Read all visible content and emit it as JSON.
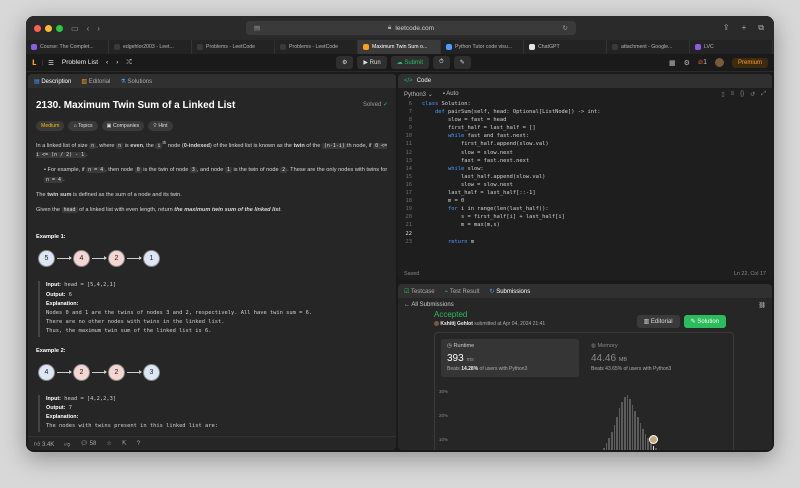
{
  "browser": {
    "url": "leetcode.com",
    "tabs": [
      {
        "label": "Course: The Complet...",
        "color": "#8c5ce6",
        "active": false
      },
      {
        "label": "edgehlor2003 - Leet...",
        "color": "#3a3a3a",
        "active": false
      },
      {
        "label": "Problems - LeetCode",
        "color": "#3a3a3a",
        "active": false
      },
      {
        "label": "Problems - LeetCode",
        "color": "#3a3a3a",
        "active": false
      },
      {
        "label": "Maximum Twin Sum o...",
        "color": "#ffa116",
        "active": true
      },
      {
        "label": "Python Tutor code visu...",
        "color": "#4a9eff",
        "active": false
      },
      {
        "label": "ChatGPT",
        "color": "#e6e6e6",
        "active": false
      },
      {
        "label": "attachment - Google...",
        "color": "#3a3a3a",
        "active": false
      },
      {
        "label": "LVC",
        "color": "#8c5ce6",
        "active": false
      }
    ]
  },
  "nav": {
    "problem_list": "Problem List",
    "run": "Run",
    "submit": "Submit",
    "streak": "1",
    "premium": "Premium"
  },
  "left": {
    "tabs": [
      "Description",
      "Editorial",
      "Solutions"
    ],
    "title": "2130. Maximum Twin Sum of a Linked List",
    "solved": "Solved",
    "pills": [
      "Medium",
      "Topics",
      "Companies",
      "Hint"
    ],
    "p1a": "In a linked list of size ",
    "p1_n": "n",
    "p1b": ", where ",
    "p1c": " is ",
    "p1_even": "even",
    "p1d": ", the ",
    "p1_ith": "i",
    "p1_th": "th",
    "p1e": " node (",
    "p1_zero": "0-indexed",
    "p1f": ") of the linked list is known as the ",
    "p1_twin": "twin",
    "p1g": " of the ",
    "p1_code": "(n-1-i)",
    "p1h": "th node, if ",
    "p1_range": "0 <= i <= (n / 2) - 1",
    "p1i": ".",
    "bullet_a": "For example, if ",
    "bullet_n4": "n = 4",
    "bullet_b": ", then node ",
    "bullet_0": "0",
    "bullet_c": " is the twin of node ",
    "bullet_3": "3",
    "bullet_d": ", and node ",
    "bullet_1": "1",
    "bullet_e": " is the twin of node ",
    "bullet_2": "2",
    "bullet_f": ". These are the only nodes with twins for ",
    "bullet_g": ".",
    "p2a": "The ",
    "p2_twin_sum": "twin sum",
    "p2b": " is defined as the sum of a node and its twin.",
    "p3a": "Given the ",
    "p3_head": "head",
    "p3b": " of a linked list with even length, return ",
    "p3_max": "the maximum twin sum of the linked list",
    "p3c": ".",
    "ex1_title": "Example 1:",
    "ex1_nodes": [
      "5",
      "4",
      "2",
      "1"
    ],
    "ex1_input_label": "Input:",
    "ex1_input": " head = [5,4,2,1]",
    "ex1_output_label": "Output:",
    "ex1_output": " 6",
    "ex1_expl_label": "Explanation:",
    "ex1_l1": "Nodes 0 and 1 are the twins of nodes 3 and 2, respectively. All have twin sum = 6.",
    "ex1_l2": "There are no other nodes with twins in the linked list.",
    "ex1_l3": "Thus, the maximum twin sum of the linked list is 6.",
    "ex2_title": "Example 2:",
    "ex2_nodes": [
      "4",
      "2",
      "2",
      "3"
    ],
    "ex2_input_label": "Input:",
    "ex2_input": " head = [4,2,2,3]",
    "ex2_output_label": "Output:",
    "ex2_output": " 7",
    "ex2_expl_label": "Explanation:",
    "ex2_l1": "The nodes with twins present in this linked list are:",
    "footer": {
      "likes": "3.4K",
      "comments": "58"
    }
  },
  "code": {
    "header": "Code",
    "language": "Python3",
    "auto": "Auto",
    "lines": [
      {
        "n": "6",
        "kw": "class ",
        "t": "Solution:"
      },
      {
        "n": "7",
        "indent": "    ",
        "kw": "def ",
        "t": "pairSum(self, head: Optional[ListNode]) -> int:"
      },
      {
        "n": "8",
        "indent": "        ",
        "kw": "",
        "t": "slow = fast = head"
      },
      {
        "n": "9",
        "indent": "        ",
        "kw": "",
        "t": "first_half = last_half = []"
      },
      {
        "n": "10",
        "indent": "        ",
        "kw": "while ",
        "t": "fast and fast.next:"
      },
      {
        "n": "11",
        "indent": "            ",
        "kw": "",
        "t": "first_half.append(slow.val)"
      },
      {
        "n": "12",
        "indent": "            ",
        "kw": "",
        "t": "slow = slow.next"
      },
      {
        "n": "13",
        "indent": "            ",
        "kw": "",
        "t": "fast = fast.next.next"
      },
      {
        "n": "14",
        "indent": "        ",
        "kw": "while ",
        "t": "slow:"
      },
      {
        "n": "15",
        "indent": "            ",
        "kw": "",
        "t": "last_half.append(slow.val)"
      },
      {
        "n": "16",
        "indent": "            ",
        "kw": "",
        "t": "slow = slow.next"
      },
      {
        "n": "17",
        "indent": "        ",
        "kw": "",
        "t": "last_half = last_half[::-1]"
      },
      {
        "n": "18",
        "indent": "        ",
        "kw": "",
        "t": "m = 0"
      },
      {
        "n": "19",
        "indent": "        ",
        "kw": "for ",
        "t": "i in range(len(last_half)):"
      },
      {
        "n": "20",
        "indent": "            ",
        "kw": "",
        "t": "s = first_half[i] + last_half[i]"
      },
      {
        "n": "21",
        "indent": "            ",
        "kw": "",
        "t": "m = max(m,s)"
      },
      {
        "n": "22",
        "indent": "        ",
        "kw": "",
        "t": "",
        "current": true
      },
      {
        "n": "23",
        "indent": "        ",
        "kw": "return ",
        "t": "m"
      }
    ],
    "saved": "Saved",
    "cursor": "Ln 22, Col 17"
  },
  "submission": {
    "tabs": [
      "Testcase",
      "Test Result",
      "Submissions"
    ],
    "all": "All Submissions",
    "status": "Accepted",
    "user": "Kshitij Gehlot",
    "submitted": " submitted at Apr 04, 2024 21:41",
    "editorial_btn": "Editorial",
    "solution_btn": "Solution",
    "runtime_label": "Runtime",
    "runtime_value": "393",
    "runtime_unit": "ms",
    "runtime_beats_a": "Beats ",
    "runtime_beats": "14.28%",
    "runtime_beats_b": " of users with Python3",
    "memory_label": "Memory",
    "memory_value": "44.46",
    "memory_unit": "MB",
    "memory_beats": "Beats 43.65% of users with Python3",
    "y_labels": [
      "30%",
      "20%",
      "10%",
      "0%"
    ],
    "histogram_heights": [
      3,
      4,
      5,
      6,
      7,
      9,
      11,
      14,
      18,
      22,
      27,
      33,
      40,
      47,
      52,
      56,
      58,
      55,
      50,
      45,
      40,
      35,
      30,
      26,
      22,
      19,
      16,
      14,
      12,
      10,
      9,
      8,
      7,
      6,
      5,
      4,
      3,
      3,
      2,
      2
    ],
    "highlight_index": 26
  }
}
